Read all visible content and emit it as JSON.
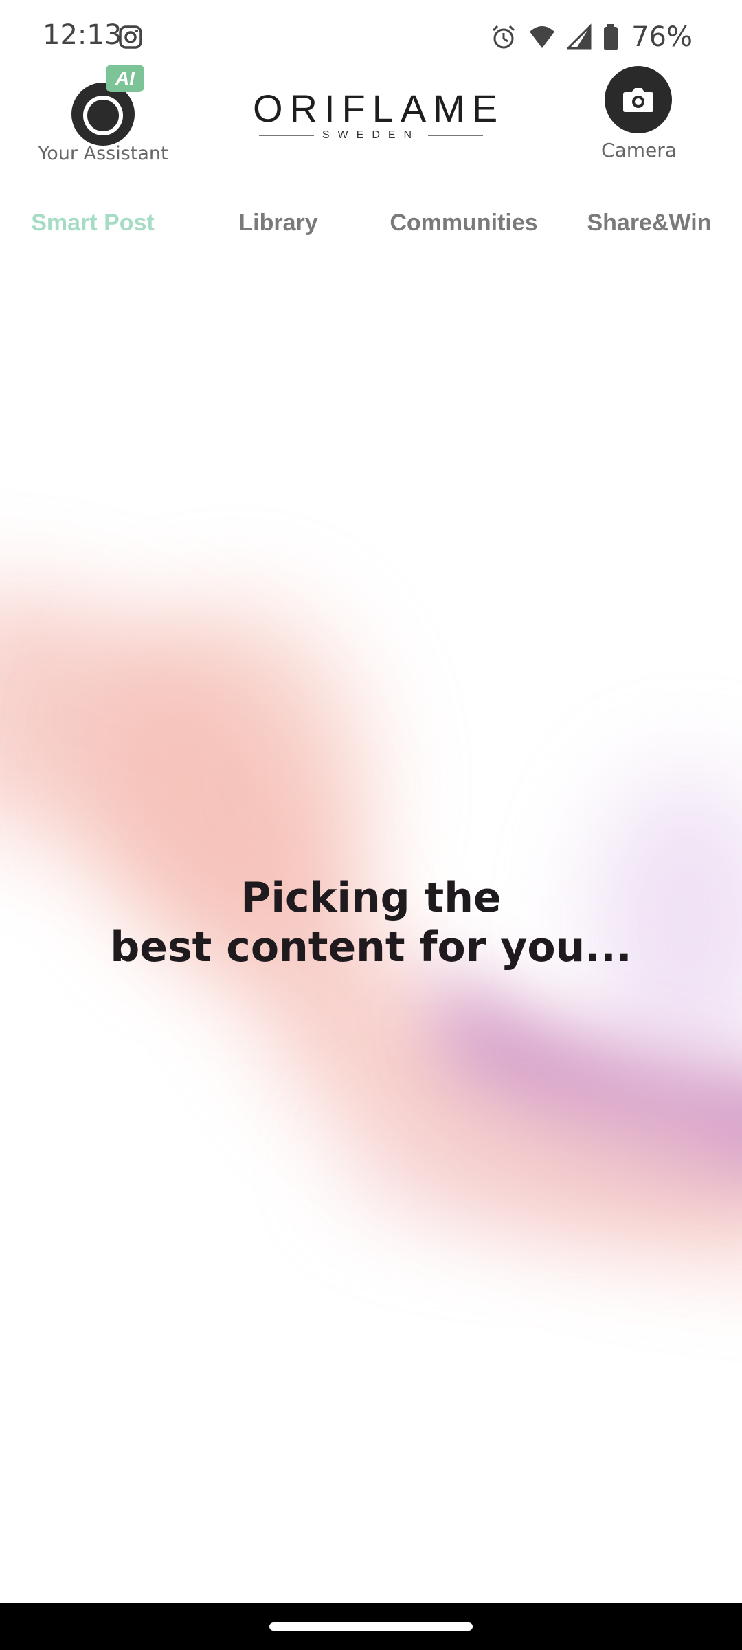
{
  "status_bar": {
    "time": "12:13",
    "battery": "76%",
    "icons": [
      "instagram-icon",
      "alarm-icon",
      "wifi-icon",
      "signal-icon",
      "battery-icon"
    ]
  },
  "header": {
    "assistant_label": "Your Assistant",
    "ai_badge": "AI",
    "brand_name": "ORIFLAME",
    "brand_sub": "SWEDEN",
    "camera_label": "Camera"
  },
  "tabs": [
    {
      "label": "Smart Post",
      "active": true
    },
    {
      "label": "Library",
      "active": false
    },
    {
      "label": "Communities",
      "active": false
    },
    {
      "label": "Share&Win",
      "active": false
    }
  ],
  "loading": {
    "line1": "Picking the",
    "line2": "best content for you..."
  },
  "colors": {
    "active_tab": "#a6dcc3",
    "inactive_tab": "#7a7a7a",
    "ai_badge": "#7cc497"
  }
}
